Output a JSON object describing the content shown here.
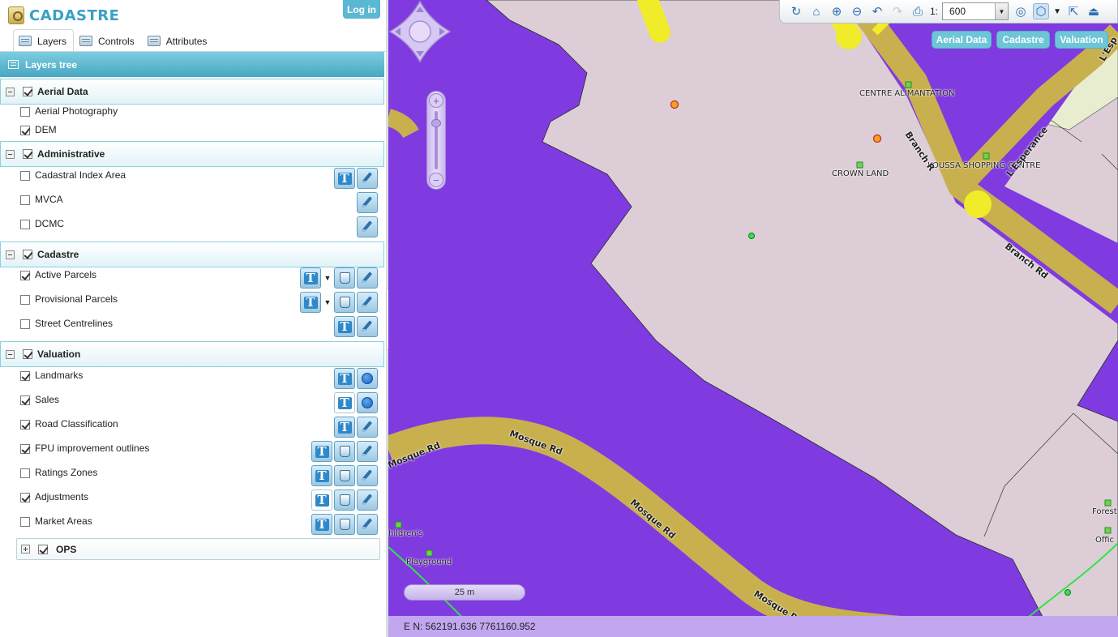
{
  "app": {
    "name": "CADASTRE",
    "login_label": "Log in"
  },
  "tabs": [
    {
      "label": "Layers",
      "icon": "layers-icon"
    },
    {
      "label": "Controls",
      "icon": "controls-icon"
    },
    {
      "label": "Attributes",
      "icon": "attributes-icon"
    }
  ],
  "tree": {
    "title": "Layers tree",
    "groups": [
      {
        "label": "Aerial Data",
        "checked": true,
        "layers": [
          {
            "label": "Aerial Photography",
            "checked": false,
            "buttons": []
          },
          {
            "label": "DEM",
            "checked": true,
            "buttons": []
          }
        ]
      },
      {
        "label": "Administrative",
        "checked": true,
        "layers": [
          {
            "label": "Cadastral Index Area",
            "checked": false,
            "buttons": [
              "label",
              "edit"
            ]
          },
          {
            "label": "MVCA",
            "checked": false,
            "buttons": [
              "edit"
            ]
          },
          {
            "label": "DCMC",
            "checked": false,
            "buttons": [
              "edit"
            ]
          }
        ]
      },
      {
        "label": "Cadastre",
        "checked": true,
        "layers": [
          {
            "label": "Active Parcels",
            "checked": true,
            "buttons": [
              "label",
              "dropdown",
              "style",
              "edit"
            ]
          },
          {
            "label": "Provisional Parcels",
            "checked": false,
            "buttons": [
              "label",
              "dropdown",
              "style",
              "edit"
            ]
          },
          {
            "label": "Street Centrelines",
            "checked": false,
            "buttons": [
              "label",
              "edit"
            ]
          }
        ]
      },
      {
        "label": "Valuation",
        "checked": true,
        "layers": [
          {
            "label": "Landmarks",
            "checked": true,
            "buttons": [
              "label",
              "point"
            ]
          },
          {
            "label": "Sales",
            "checked": true,
            "buttons": [
              "label-plain",
              "point"
            ]
          },
          {
            "label": "Road Classification",
            "checked": true,
            "buttons": [
              "label",
              "edit"
            ]
          },
          {
            "label": "FPU improvement outlines",
            "checked": true,
            "buttons": [
              "label",
              "style",
              "edit"
            ]
          },
          {
            "label": "Ratings Zones",
            "checked": false,
            "buttons": [
              "label",
              "style",
              "edit"
            ]
          },
          {
            "label": "Adjustments",
            "checked": true,
            "buttons": [
              "label-plain",
              "style",
              "edit"
            ]
          },
          {
            "label": "Market Areas",
            "checked": false,
            "buttons": [
              "label",
              "style",
              "edit"
            ]
          }
        ]
      }
    ],
    "collapsed_group": {
      "label": "OPS",
      "checked": true
    }
  },
  "toolbar": {
    "scale_prefix": "1:",
    "scale_value": "600",
    "tools": [
      "refresh-icon",
      "home-icon",
      "zoom-in-icon",
      "zoom-out-icon",
      "undo-icon",
      "redo-icon",
      "print-icon"
    ]
  },
  "map_tabs": [
    "Aerial Data",
    "Cadastre",
    "Valuation"
  ],
  "map": {
    "labels": [
      "CENTRE ALIMANTATION",
      "CROWN LAND",
      "KOUSSA SHOPPING CENTRE",
      "Forest",
      "Offic",
      "hildren's",
      "Playground"
    ],
    "roads": [
      "Branch R",
      "Branch Rd",
      "L'Esperance",
      "L'Esp",
      "Mosque Rd"
    ],
    "scale_bar": "25 m",
    "coords": "E N: 562191.636 7761160.952"
  },
  "colors": {
    "accent": "#5bb8d2",
    "map_zone": "#7f3be0",
    "map_parcel": "#dccdd6",
    "map_road": "#c9b04e"
  }
}
